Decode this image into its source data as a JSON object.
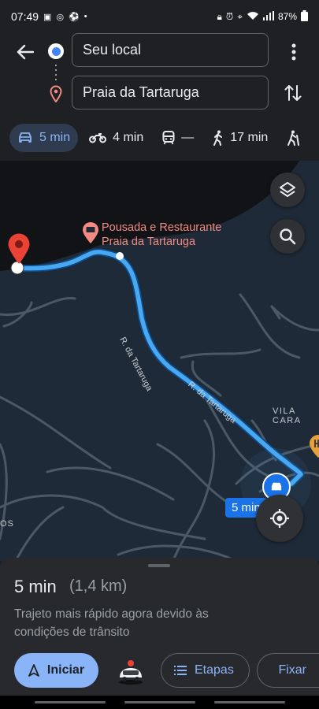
{
  "status_bar": {
    "time": "07:49",
    "battery": "87%"
  },
  "header": {
    "origin": "Seu local",
    "destination": "Praia da Tartaruga"
  },
  "modes": [
    {
      "icon": "car-icon",
      "label": "5 min",
      "active": true
    },
    {
      "icon": "motorcycle-icon",
      "label": "4 min"
    },
    {
      "icon": "transit-icon",
      "label": "—"
    },
    {
      "icon": "walk-icon",
      "label": "17 min"
    },
    {
      "icon": "hike-icon",
      "label": ""
    }
  ],
  "map": {
    "poi_line1": "Pousada e Restaurante",
    "poi_line2": "Praia da Tartaruga",
    "street1": "R. da Tartaruga",
    "street2": "R. da Tartaruga",
    "area_label": "VILA CARA",
    "eta_chip": "5 min",
    "edge_label1": "ho",
    "edge_label2": "OS"
  },
  "summary": {
    "time": "5 min",
    "distance": "(1,4 km)",
    "description": "Trajeto mais rápido agora devido às condições de trânsito"
  },
  "actions": {
    "start": "Iniciar",
    "steps": "Etapas",
    "pin": "Fixar"
  },
  "colors": {
    "route": "#4aa8f0",
    "accent": "#8ab4f8",
    "dest_pin": "#ea4335"
  }
}
